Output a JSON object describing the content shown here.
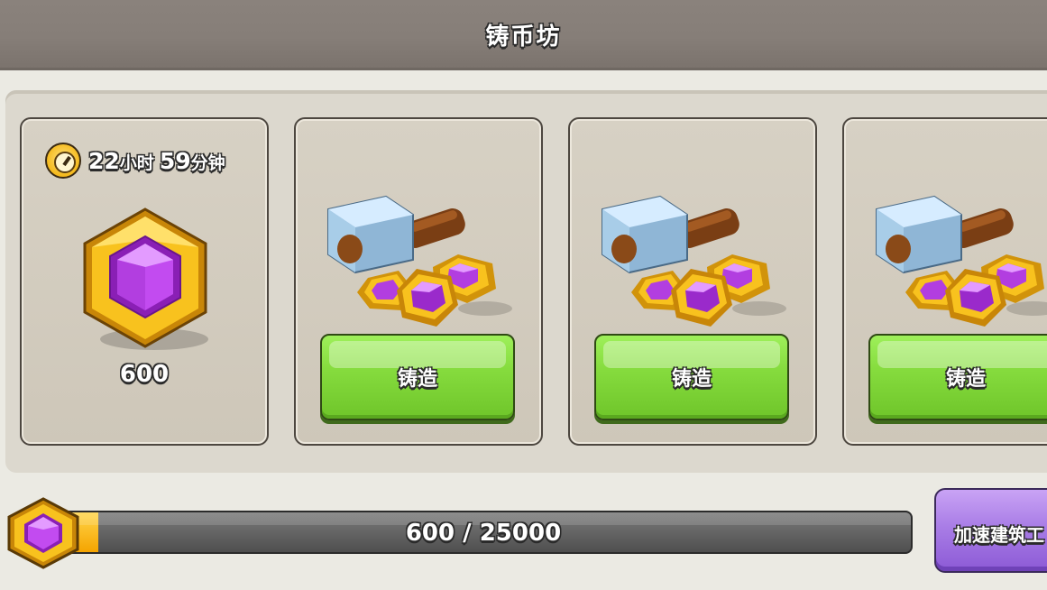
{
  "header": {
    "title": "铸币坊"
  },
  "storage_card": {
    "timer": {
      "hours": "22",
      "hours_unit": "小时",
      "minutes": "59",
      "minutes_unit": "分钟"
    },
    "value": "600",
    "icon": "purple-gem-icon"
  },
  "forge_cards": [
    {
      "button_label": "铸造",
      "icon": "hammer-gems-icon"
    },
    {
      "button_label": "铸造",
      "icon": "hammer-gems-icon"
    },
    {
      "button_label": "铸造",
      "icon": "hammer-gems-icon"
    }
  ],
  "progress": {
    "current": 600,
    "max": 25000,
    "label": "600 / 25000",
    "icon": "purple-gem-icon"
  },
  "speed_up_button": {
    "label": "加速建筑工"
  },
  "colors": {
    "header": "#867e78",
    "forge_button": "#86dc3e",
    "speed_button": "#a97de6",
    "gem_purple": "#b23ee0",
    "gem_gold": "#f5b91c"
  }
}
